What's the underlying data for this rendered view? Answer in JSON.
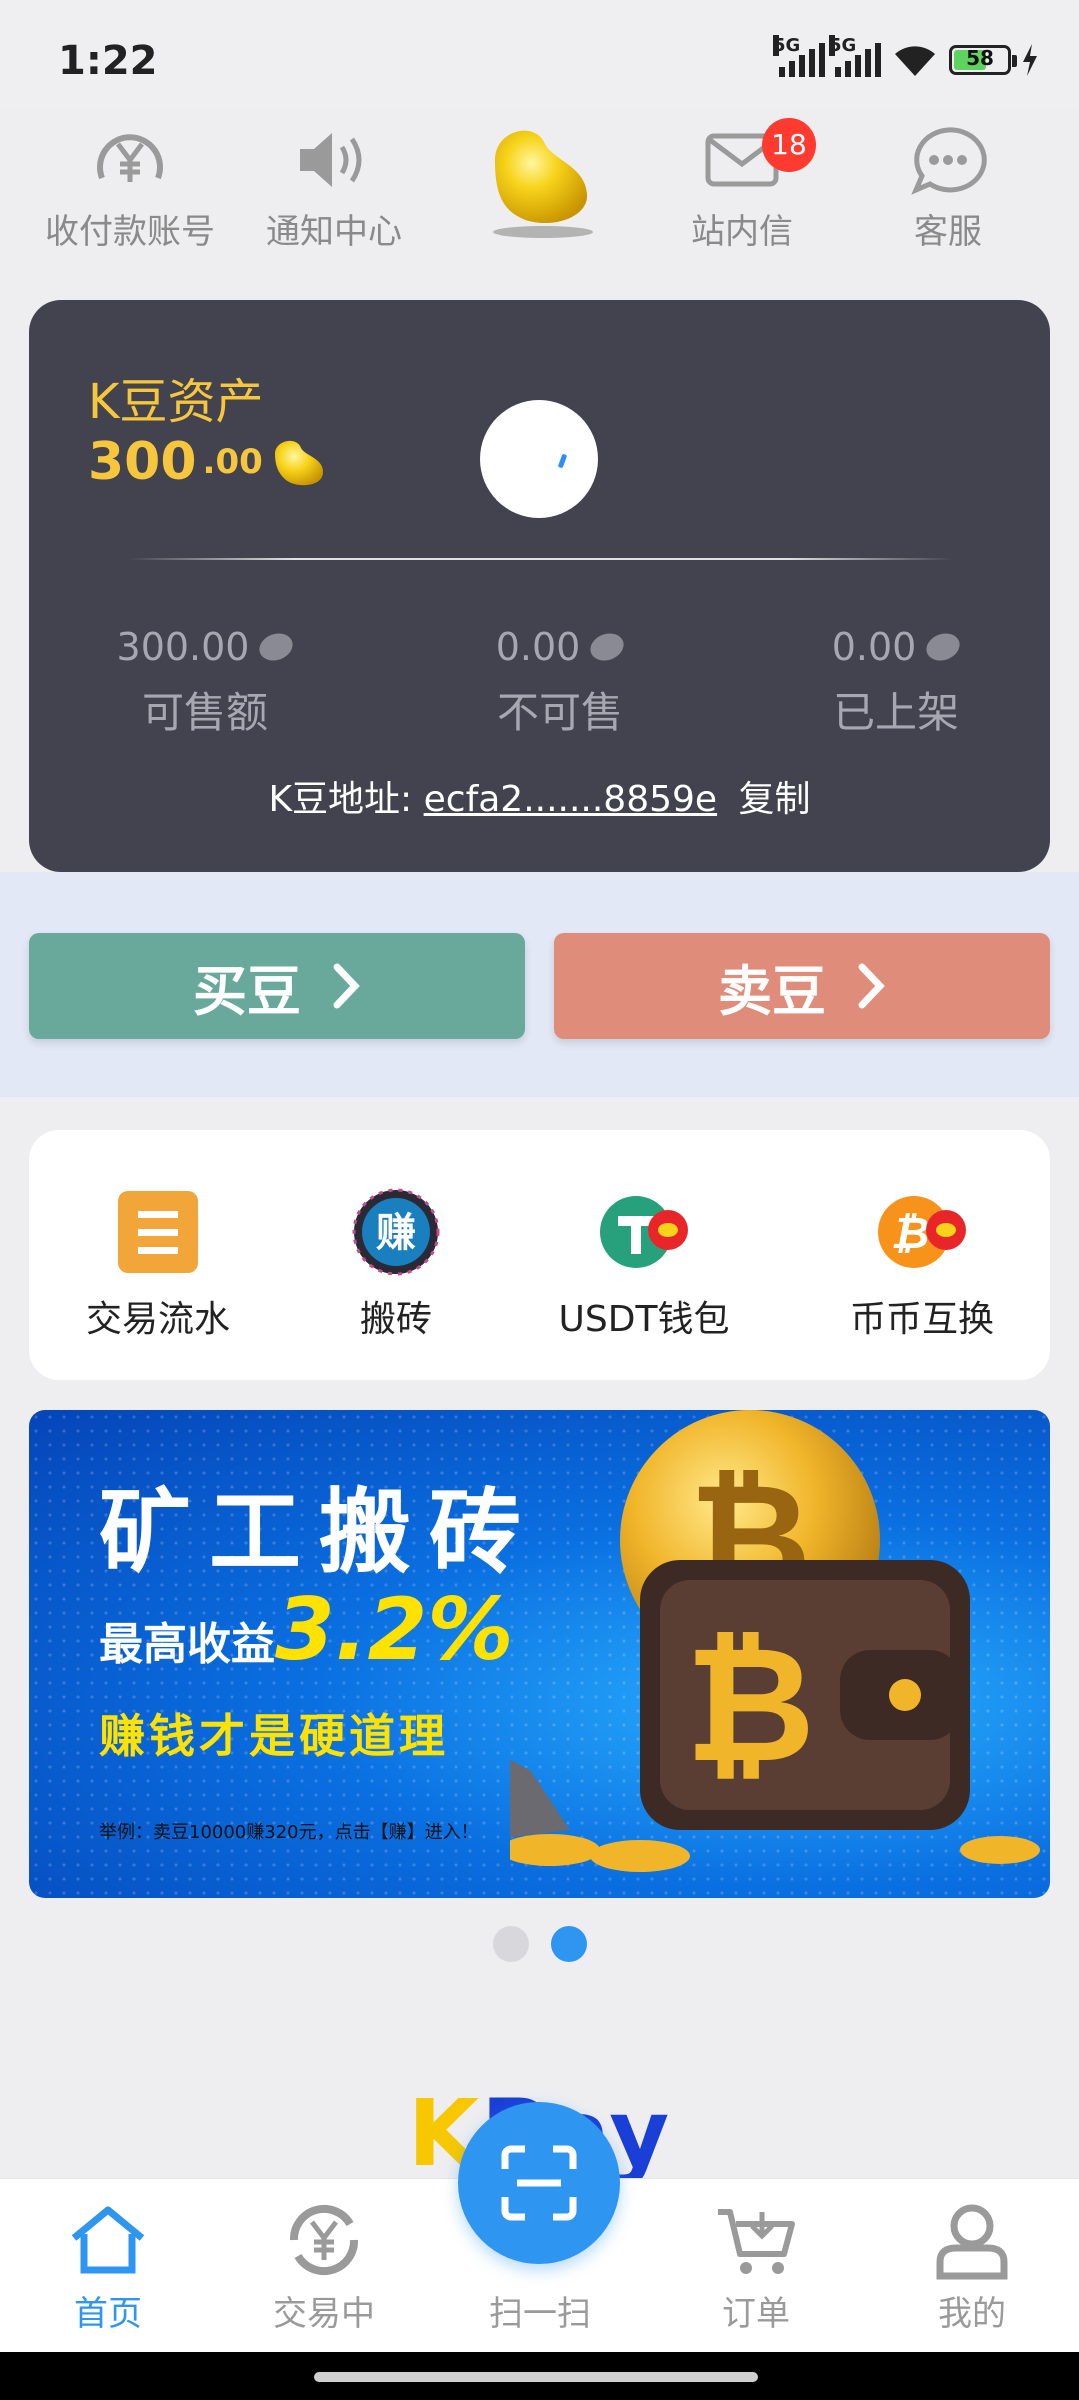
{
  "status": {
    "time": "1:22",
    "signal_1": "5G",
    "signal_2": "5G",
    "battery": "58"
  },
  "topnav": {
    "items": [
      {
        "label": "收付款账号",
        "icon": "yen-circle-icon"
      },
      {
        "label": "通知中心",
        "icon": "speaker-icon"
      },
      {
        "label": "",
        "icon": "golden-bean-logo"
      },
      {
        "label": "站内信",
        "icon": "mail-icon",
        "badge": "18"
      },
      {
        "label": "客服",
        "icon": "chat-bubble-icon"
      }
    ]
  },
  "asset": {
    "title": "K豆资产",
    "amount_int": "300",
    "amount_dec": ".00",
    "stats": [
      {
        "value": "300.00",
        "label": "可售额"
      },
      {
        "value": "0.00",
        "label": "不可售"
      },
      {
        "value": "0.00",
        "label": "已上架"
      }
    ],
    "address_label": "K豆地址: ",
    "address_value": "ecfa2.......8859e",
    "copy_label": "复制"
  },
  "actions": {
    "buy": "买豆",
    "sell": "卖豆",
    "buy_color": "#68a99b",
    "sell_color": "#e08c7a"
  },
  "functions": [
    {
      "label": "交易流水",
      "icon": "ledger-icon"
    },
    {
      "label": "搬砖",
      "icon": "earn-icon",
      "icon_text": "赚"
    },
    {
      "label": "USDT钱包",
      "icon": "usdt-wallet-icon"
    },
    {
      "label": "币币互换",
      "icon": "coin-swap-icon"
    }
  ],
  "banner": {
    "title": "矿工搬砖",
    "sub_prefix": "最高收益",
    "rate": "3.2%",
    "slogan": "赚钱才是硬道理",
    "note": "举例：卖豆10000赚320元，点击【赚】进入！",
    "pages": 2,
    "active_page": 2
  },
  "footer_logo": {
    "part1": "K",
    "part2": "Pay"
  },
  "tabbar": {
    "items": [
      {
        "label": "首页",
        "icon": "home-icon",
        "active": true
      },
      {
        "label": "交易中",
        "icon": "yen-refresh-icon",
        "active": false
      },
      {
        "label": "扫一扫",
        "icon": "scan-icon",
        "active": false
      },
      {
        "label": "订单",
        "icon": "cart-icon",
        "active": false
      },
      {
        "label": "我的",
        "icon": "user-icon",
        "active": false
      }
    ]
  },
  "accent_color": "#2e95f0"
}
